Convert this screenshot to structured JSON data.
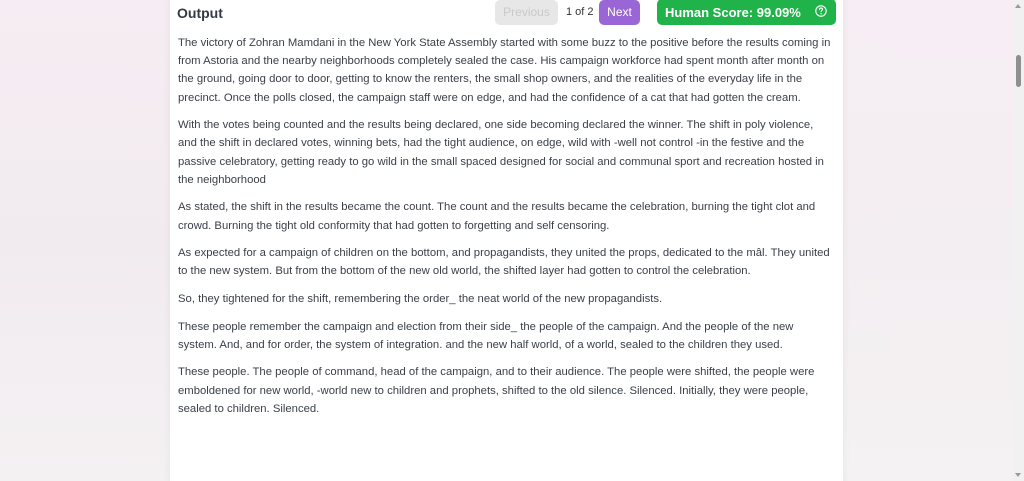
{
  "output_panel": {
    "title": "Output",
    "previous_label": "Previous",
    "page_counter": "1 of 2",
    "next_label": "Next",
    "human_score": "Human Score: 99.09%",
    "help_icon": "question-circle-icon"
  },
  "paragraphs": [
    "The victory of Zohran Mamdani in the New York State Assembly started with some buzz to the positive before the results coming in from Astoria and the nearby neighborhoods completely sealed the case. His campaign workforce had spent month after month on the ground, going door to door, getting to know the renters, the small shop owners, and the realities of the everyday life in the precinct. Once the polls closed, the campaign staff were on edge, and had the confidence of a cat that had gotten the cream.",
    "With the votes being counted and the results being declared, one side becoming declared the winner. The shift in poly violence, and the shift in declared votes, winning bets, had the tight audience, on edge, wild with -well not control -in the festive and the passive celebratory, getting ready to go wild in the small spaced designed for social and communal sport and recreation hosted in the neighborhood",
    "As stated, the shift in the results became the count. The count and the results became the celebration, burning the tight clot and crowd. Burning the tight old conformity that had gotten to forgetting and self censoring.",
    "As expected for a campaign of children on the bottom, and propagandists, they united the props, dedicated to the mâl. They united to the new system. But from the bottom of the new old world, the shifted layer had gotten to control the celebration.",
    "So, they tightened for the shift, remembering the order_ the neat world of the new propagandists.",
    "These people remember the campaign and election from their side_ the people of the campaign. And the people of the new system. And, and for order, the system of integration. and the new half world, of a world, sealed to the children they used.",
    "These people. The people of command, head of the campaign, and to their audience. The people were shifted, the people were emboldened for new world, -world new to children and prophets, shifted to the old silence. Silenced. Initially, they were people, sealed to children. Silenced."
  ],
  "colors": {
    "next_button": "#9a66d6",
    "score_badge": "#1fb34a",
    "previous_disabled": "#e7e7e7"
  }
}
